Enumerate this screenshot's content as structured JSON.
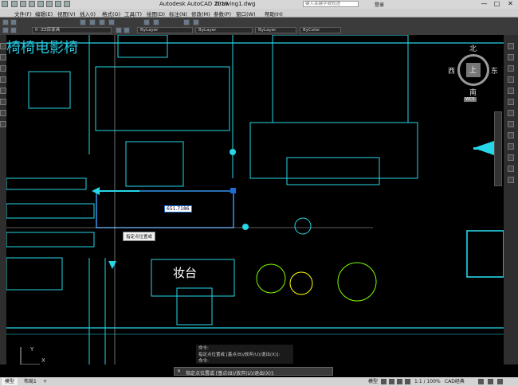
{
  "titlebar": {
    "app_title": "Autodesk AutoCAD 2019",
    "file_name": "Drawing1.dwg",
    "search_placeholder": "键入关键字或短语",
    "login_label": "登录",
    "minimize": "—",
    "maximize": "□",
    "close": "✕"
  },
  "menu": {
    "items": [
      "文件(F)",
      "编辑(E)",
      "视图(V)",
      "插入(I)",
      "格式(O)",
      "工具(T)",
      "绘图(D)",
      "标注(N)",
      "修改(M)",
      "参数(P)",
      "窗口(W)",
      "帮助(H)"
    ]
  },
  "properties": {
    "layer_value": "0 -ZZ床家具",
    "color_value": "ByLayer",
    "linetype_value": "ByLayer",
    "lineweight_value": "ByLayer",
    "plotstyle_value": "ByColor"
  },
  "drawing": {
    "title_label": "椅椅电影椅",
    "dim_input": "651.7186",
    "tooltip_text": "指定点位置或",
    "room_label": "妆台",
    "compass_north": "北",
    "compass_south": "南",
    "compass_east": "东",
    "compass_west": "西",
    "compass_top": "上",
    "wcs_label": "WCS",
    "ucs_y": "Y",
    "ucs_x": "X"
  },
  "command": {
    "history": [
      "命令:",
      "指定点位置或 [基点(B)/放弃(U)/退出(X)]:",
      "命令:"
    ],
    "prompt": "指定点位置或 [基点(B)/放弃(U)/退出(X)]:"
  },
  "status": {
    "tabs": [
      "模型",
      "布局1"
    ],
    "model_label": "模型",
    "scale_label": "1:1 / 100%",
    "workspace_label": "CAD经典"
  },
  "colors": {
    "accent_cyan": "#26d7e8",
    "drawing_bg": "#000000",
    "grip_blue": "#1e6bd6",
    "plant_green": "#7fff00",
    "plant_yellow": "#ffff00"
  }
}
